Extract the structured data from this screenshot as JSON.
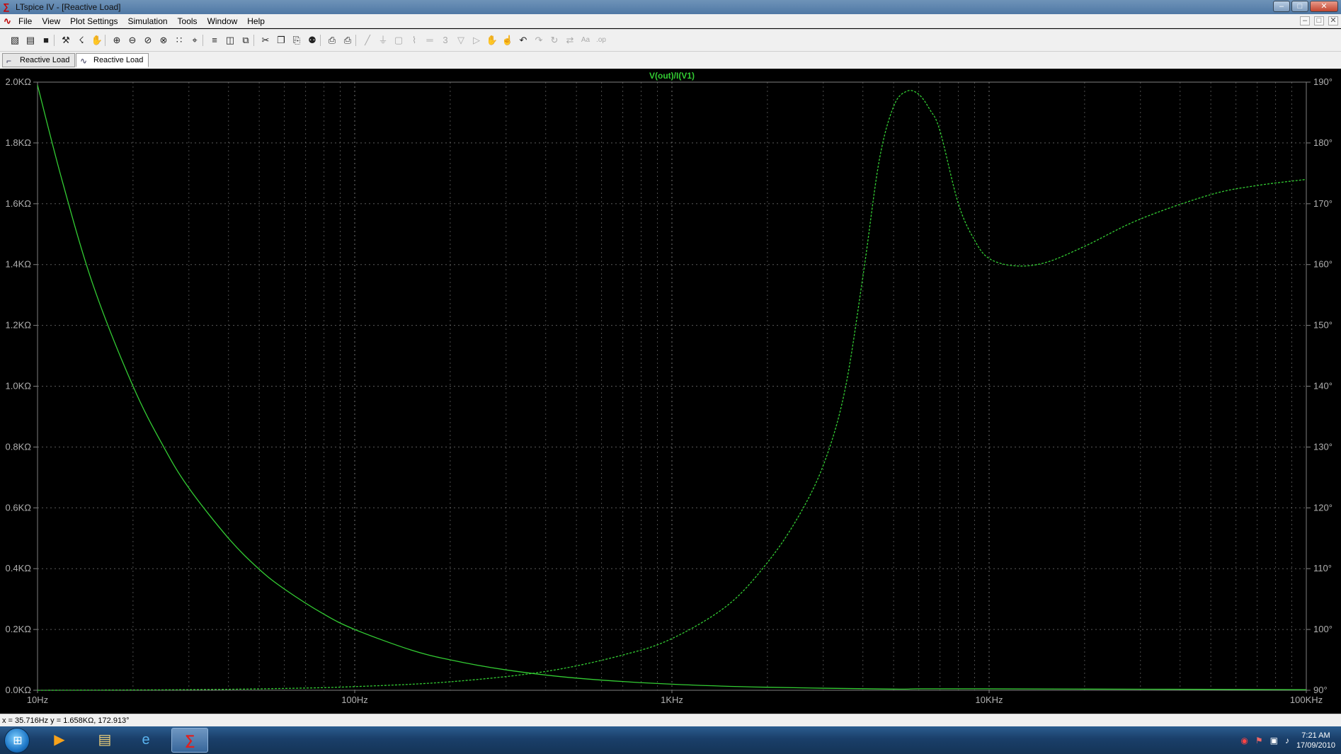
{
  "window": {
    "title": "LTspice IV - [Reactive Load]",
    "buttons": [
      "–",
      "□",
      "✕"
    ]
  },
  "menu": {
    "items": [
      "File",
      "View",
      "Plot Settings",
      "Simulation",
      "Tools",
      "Window",
      "Help"
    ],
    "mdi_buttons": [
      "–",
      "□",
      "✕"
    ]
  },
  "toolbar": {
    "icons": [
      "new-schematic-icon",
      "open-icon",
      "save-icon",
      "control-panel-icon",
      "run-icon",
      "halt-icon",
      "zoom-in-icon",
      "zoom-out-icon",
      "zoom-fit-icon",
      "zoom-cancel-icon",
      "autorange-icon",
      "add-trace-icon",
      "tile-horizontal-icon",
      "tile-vertical-icon",
      "cascade-icon",
      "cut-icon",
      "copy-icon",
      "paste-icon",
      "find-icon",
      "print-preview-icon",
      "print-icon",
      "wire-icon",
      "ground-icon",
      "label-icon",
      "resistor-icon",
      "capacitor-icon",
      "inductor-icon",
      "diode-icon",
      "component-icon",
      "move-icon",
      "drag-icon",
      "undo-icon",
      "redo-icon",
      "rotate-icon",
      "mirror-icon",
      "text-icon",
      "spice-directive-icon"
    ]
  },
  "tabs": [
    {
      "label": "Reactive Load",
      "icon": "schematic-icon",
      "active": false
    },
    {
      "label": "Reactive Load",
      "icon": "waveform-icon",
      "active": true
    }
  ],
  "statusbar": {
    "cursor": "x = 35.716Hz    y = 1.658KΩ, 172.913°"
  },
  "taskbar": {
    "time": "7:21 AM",
    "date": "17/09/2010"
  },
  "colors": {
    "trace": "#33cc33",
    "grid": "#808080",
    "axis_text": "#b0b0b0"
  },
  "chart_data": {
    "type": "line",
    "title": "V(out)/I(V1)",
    "xscale": "log",
    "xlim": [
      10,
      100000
    ],
    "x_ticks": [
      "10Hz",
      "100Hz",
      "1KHz",
      "10KHz",
      "100KHz"
    ],
    "ylim_left": [
      0,
      2000
    ],
    "y_left_ticks": [
      "2.0KΩ",
      "1.8KΩ",
      "1.6KΩ",
      "1.4KΩ",
      "1.2KΩ",
      "1.0KΩ",
      "0.8KΩ",
      "0.6KΩ",
      "0.4KΩ",
      "0.2KΩ",
      "0.0KΩ"
    ],
    "ylim_right": [
      90,
      190
    ],
    "y_right_ticks": [
      "190°",
      "180°",
      "170°",
      "160°",
      "150°",
      "140°",
      "130°",
      "120°",
      "110°",
      "100°",
      "90°"
    ],
    "grid": true,
    "series": [
      {
        "axis": "left",
        "style": "solid",
        "x": [
          10,
          12,
          15,
          20,
          25,
          30,
          40,
          50,
          60,
          80,
          100,
          150,
          200,
          300,
          500,
          1000,
          2000,
          5000,
          6000,
          10000,
          20000,
          50000,
          100000
        ],
        "y": [
          1990,
          1670,
          1330,
          1000,
          800,
          665,
          500,
          398,
          333,
          250,
          200,
          133,
          100,
          67,
          40,
          20,
          10,
          4,
          5,
          5,
          4,
          3,
          2
        ]
      },
      {
        "axis": "right",
        "style": "dashed",
        "x": [
          10,
          30,
          60,
          100,
          200,
          400,
          700,
          1000,
          1500,
          2000,
          2500,
          3000,
          3500,
          4000,
          4500,
          5000,
          5500,
          6000,
          6500,
          7000,
          8000,
          9000,
          10000,
          12000,
          15000,
          20000,
          30000,
          50000,
          70000,
          100000
        ],
        "y": [
          90,
          90.1,
          90.3,
          90.6,
          91.4,
          93.1,
          95.8,
          98.5,
          104,
          111,
          118.5,
          127,
          139,
          158,
          177,
          186,
          188.5,
          188,
          185.5,
          182,
          170,
          164,
          161,
          159.8,
          160.3,
          163,
          167.5,
          171.5,
          173,
          174
        ]
      }
    ]
  }
}
